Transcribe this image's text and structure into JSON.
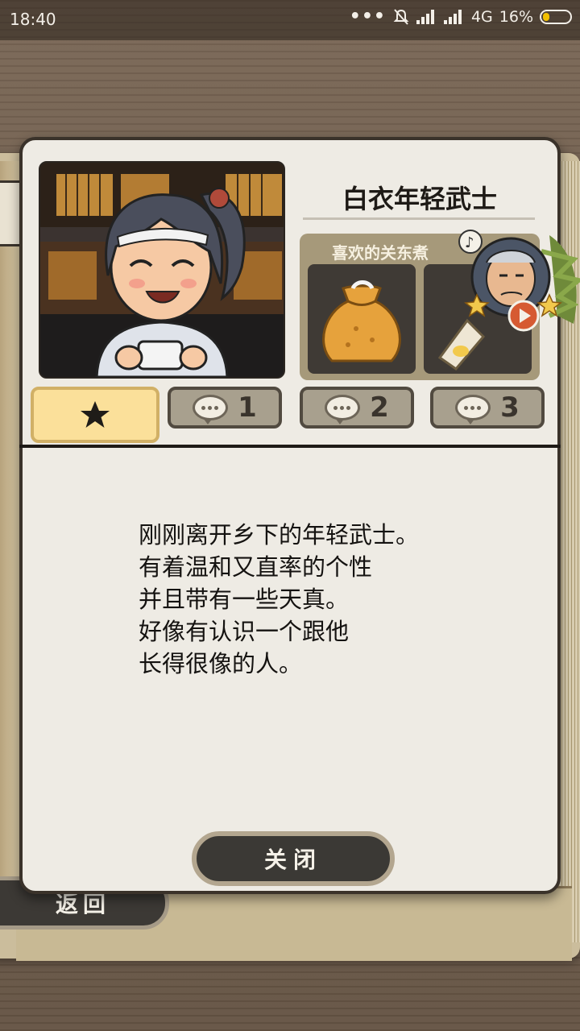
{
  "status_bar": {
    "time": "18:40",
    "dots": "•••",
    "network": "4G",
    "battery": "16%",
    "battery_level": 0.16
  },
  "profile": {
    "name": "白衣年轻武士",
    "likes_title": "喜欢的关东煮",
    "likes": [
      {
        "icon": "money-bag-dumpling-icon"
      },
      {
        "icon": "fishcake-icon"
      }
    ]
  },
  "tabs": [
    {
      "icon": "star-icon",
      "label": ""
    },
    {
      "icon": "speech-bubble-icon",
      "label": "1"
    },
    {
      "icon": "speech-bubble-icon",
      "label": "2"
    },
    {
      "icon": "speech-bubble-icon",
      "label": "3"
    }
  ],
  "description": {
    "lines": [
      "刚刚离开乡下的年轻武士。",
      "有着温和又直率的个性",
      "并且带有一些天真。",
      "好像有认识一个跟他",
      "长得很像的人。"
    ]
  },
  "buttons": {
    "close": "关闭",
    "back": "返回"
  },
  "colors": {
    "panel_bg": "#eeebe4",
    "active_tab": "#fbe09a",
    "tab_bg": "#a8a08e",
    "likes_bg": "#a6997a",
    "button_dark": "#3b3935"
  }
}
